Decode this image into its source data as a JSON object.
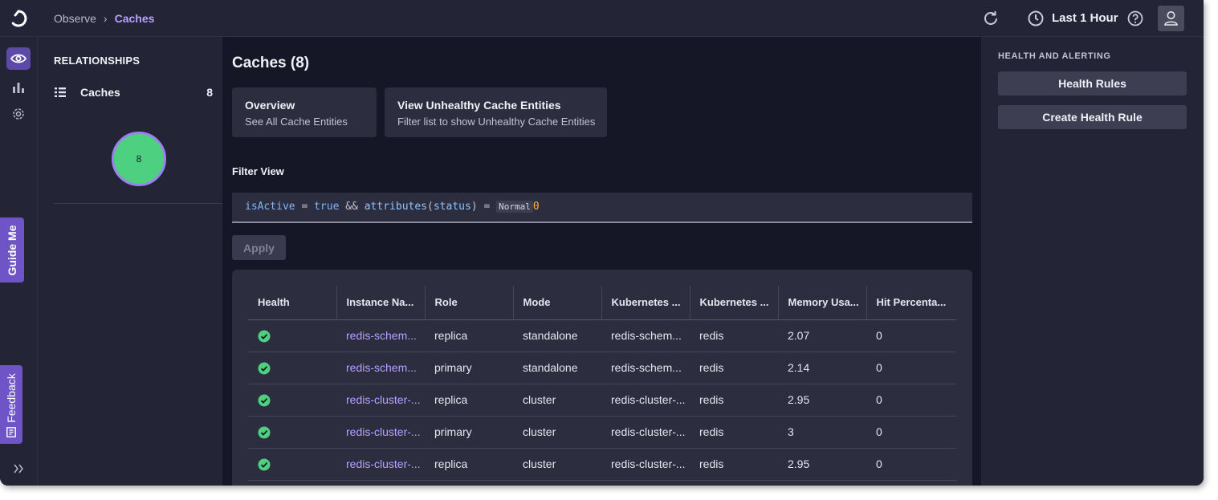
{
  "topbar": {
    "breadcrumb": {
      "parent": "Observe",
      "current": "Caches"
    },
    "time_range": "Last 1 Hour"
  },
  "rail": {
    "guide_label": "Guide Me",
    "feedback_label": "Feedback"
  },
  "relationships": {
    "title": "RELATIONSHIPS",
    "item_label": "Caches",
    "item_count": "8",
    "bubble_count": "8"
  },
  "main": {
    "title": "Caches (8)",
    "cards": [
      {
        "title": "Overview",
        "subtitle": "See All Cache Entities"
      },
      {
        "title": "View Unhealthy Cache Entities",
        "subtitle": "Filter list to show Unhealthy Cache Entities"
      }
    ],
    "filter_label": "Filter View",
    "query": {
      "p1": "isActive",
      "p2": " = ",
      "p3": "true",
      "p4": " && ",
      "p5": "attributes",
      "p6": "(",
      "p7": "status",
      "p8": ") = ",
      "p9": "Normal",
      "p10": "0"
    },
    "apply_label": "Apply",
    "table": {
      "headers": [
        "Health",
        "Instance Na...",
        "Role",
        "Mode",
        "Kubernetes ...",
        "Kubernetes ...",
        "Memory Usa...",
        "Hit Percenta..."
      ],
      "rows": [
        {
          "health": "healthy",
          "instance": "redis-schem...",
          "role": "replica",
          "mode": "standalone",
          "k8s1": "redis-schem...",
          "k8s2": "redis",
          "memory": "2.07",
          "hit": "0"
        },
        {
          "health": "healthy",
          "instance": "redis-schem...",
          "role": "primary",
          "mode": "standalone",
          "k8s1": "redis-schem...",
          "k8s2": "redis",
          "memory": "2.14",
          "hit": "0"
        },
        {
          "health": "healthy",
          "instance": "redis-cluster-...",
          "role": "replica",
          "mode": "cluster",
          "k8s1": "redis-cluster-...",
          "k8s2": "redis",
          "memory": "2.95",
          "hit": "0"
        },
        {
          "health": "healthy",
          "instance": "redis-cluster-...",
          "role": "primary",
          "mode": "cluster",
          "k8s1": "redis-cluster-...",
          "k8s2": "redis",
          "memory": "3",
          "hit": "0"
        },
        {
          "health": "healthy",
          "instance": "redis-cluster-...",
          "role": "replica",
          "mode": "cluster",
          "k8s1": "redis-cluster-...",
          "k8s2": "redis",
          "memory": "2.95",
          "hit": "0"
        }
      ]
    }
  },
  "health_panel": {
    "title": "HEALTH AND ALERTING",
    "rules_label": "Health Rules",
    "create_label": "Create Health Rule"
  },
  "icons": {
    "logo": "app-logo",
    "refresh": "refresh-icon",
    "clock": "clock-icon",
    "help": "help-icon",
    "user": "user-icon",
    "observe": "eye-icon",
    "dashboards": "bar-chart-icon",
    "settings": "gear-icon",
    "expand": "double-chevron-right-icon",
    "healthy": "check-circle-icon"
  },
  "colors": {
    "accent": "#b8a2ff",
    "healthy": "#4dd07f",
    "guide_tab": "#6e54c7"
  }
}
